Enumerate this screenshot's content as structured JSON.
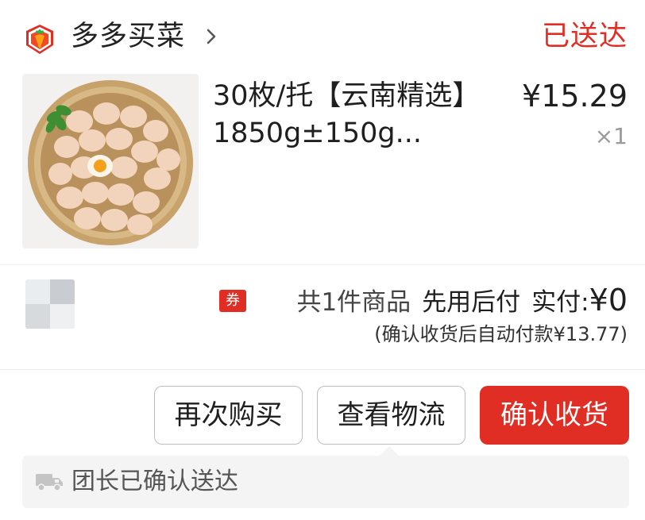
{
  "store": {
    "name": "多多买菜",
    "logo_icon": "carrot-logo-icon",
    "chevron_icon": "chevron-right-icon"
  },
  "order": {
    "status": "已送达",
    "status_color": "#e02e24"
  },
  "product": {
    "title": "30枚/托【云南精选】1850g±150g...",
    "price": "¥15.29",
    "quantity": "×1",
    "image_icon": "egg-basket-image"
  },
  "summary": {
    "coupon_badge": "券",
    "item_count": "共1件商品",
    "pay_later": "先用后付",
    "paid_label": "实付:",
    "paid_amount": "¥0",
    "auto_pay_note": "(确认收货后自动付款¥13.77)"
  },
  "actions": {
    "rebuy": "再次购买",
    "view_logistics": "查看物流",
    "confirm_receipt": "确认收货",
    "accent_color": "#e02e24"
  },
  "delivery": {
    "icon": "truck-icon",
    "text": "团长已确认送达"
  }
}
